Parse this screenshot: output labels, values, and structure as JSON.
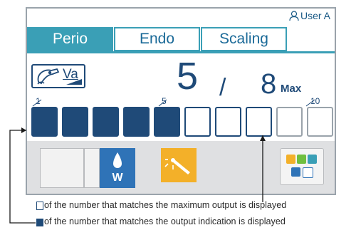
{
  "header": {
    "user_label": "User A"
  },
  "tabs": [
    {
      "label": "Perio",
      "active": true
    },
    {
      "label": "Endo",
      "active": false
    },
    {
      "label": "Scaling",
      "active": false
    }
  ],
  "handpiece": {
    "label": "Va",
    "icon": "scaler-handpiece-icon"
  },
  "output": {
    "current": "5",
    "separator": "/",
    "max": "8",
    "max_label": "Max"
  },
  "scale": {
    "label_1": "1",
    "label_5": "5",
    "label_10": "10",
    "level": 5,
    "max_level": 8,
    "segments": 10
  },
  "buttons": {
    "water_label": "W",
    "water_icon": "water-drop-icon",
    "light_icon": "handpiece-light-icon",
    "menu_icon": "settings-menu-icon"
  },
  "captions": {
    "max_output": "of the number that matches the maximum output is displayed",
    "output_indication": "of the number that matches the output indication is displayed"
  },
  "colors": {
    "accent": "#3a9fb6",
    "segment": "#1f4a78",
    "water": "#2f73b7",
    "light": "#f3b029",
    "bar": "#dfe0e2"
  }
}
